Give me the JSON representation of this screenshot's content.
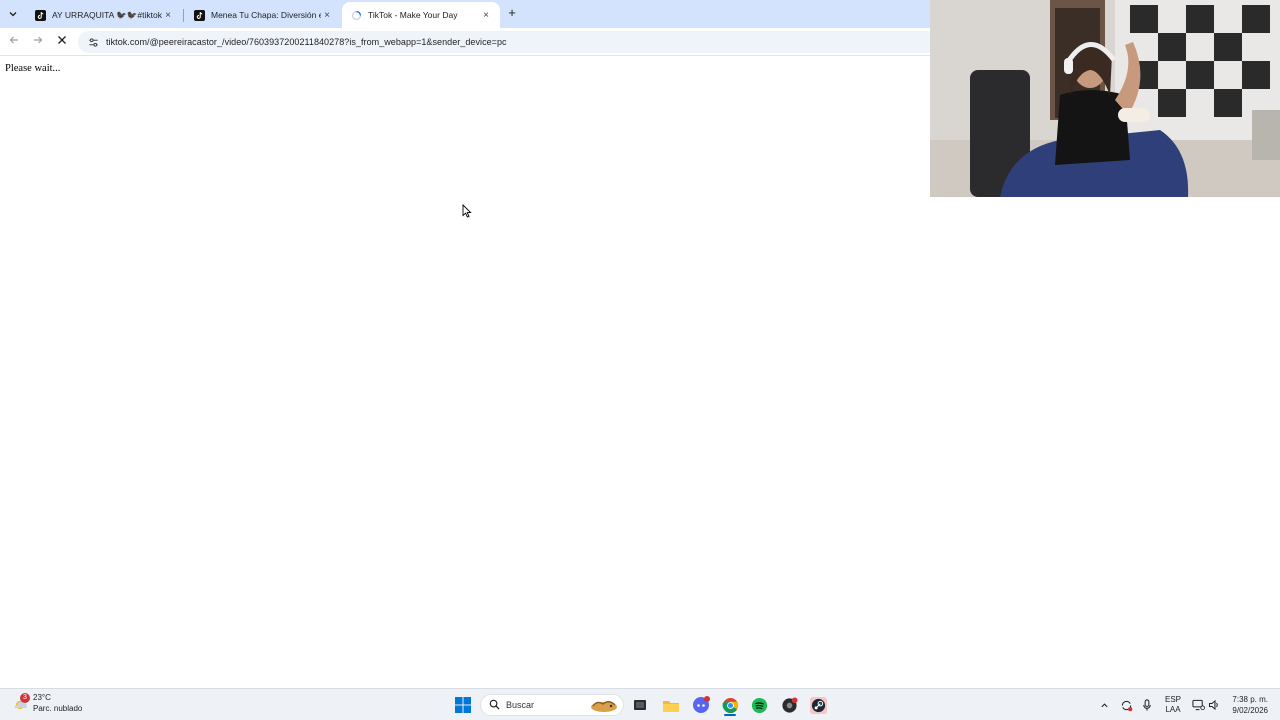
{
  "browser": {
    "tabs": [
      {
        "title": "AY URRAQUITA 🐦‍⬛🐦‍⬛#tiktok #",
        "active": false,
        "favicon": "tiktok-icon"
      },
      {
        "title": "Menea Tu Chapa: Diversión en",
        "active": false,
        "favicon": "tiktok-icon"
      },
      {
        "title": "TikTok - Make Your Day",
        "active": true,
        "favicon": "loading-icon"
      }
    ],
    "close_glyph": "×",
    "new_tab_glyph": "+",
    "url": "tiktok.com/@peereiracastor_/video/7603937200211840278?is_from_webapp=1&sender_device=pc"
  },
  "page": {
    "message": "Please wait..."
  },
  "taskbar": {
    "weather": {
      "temp": "23°C",
      "condition": "Parc. nublado",
      "badge": "3"
    },
    "search_placeholder": "Buscar",
    "language": {
      "line1": "ESP",
      "line2": "LAA"
    },
    "clock": {
      "time": "7:38 p. m.",
      "date": "9/02/2026"
    },
    "accent": "#0067c0"
  }
}
